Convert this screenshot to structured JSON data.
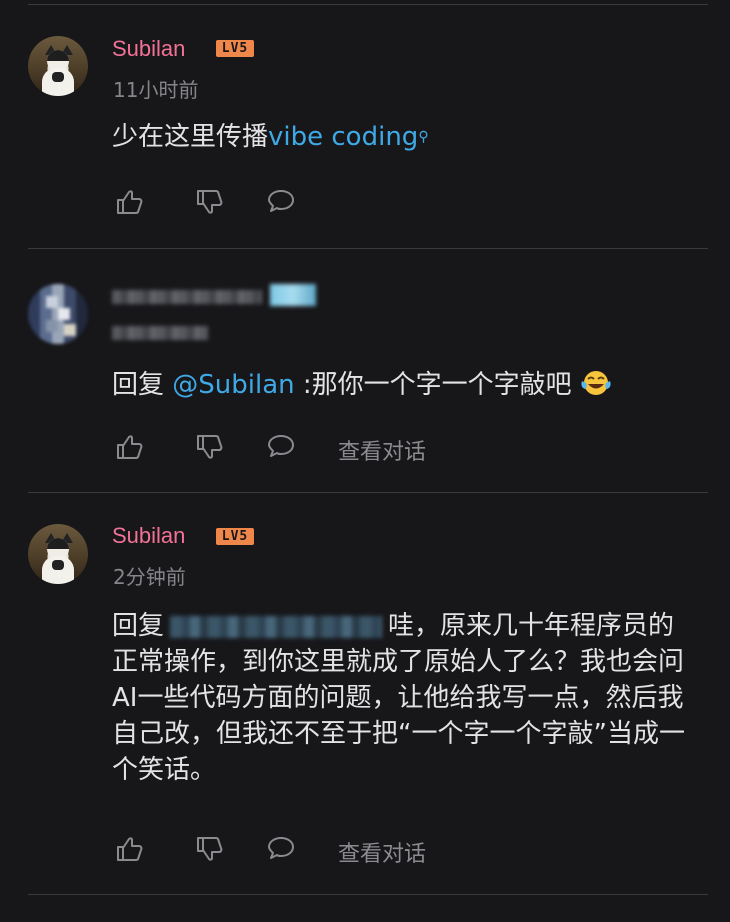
{
  "comments": [
    {
      "username": "Subilan",
      "level": "LV5",
      "time": "11小时前",
      "text_before": "少在这里传播",
      "link": "vibe coding",
      "link_icon": "search-icon"
    },
    {
      "reply_prefix": "回复 ",
      "mention": "@Subilan",
      "text": " :那你一个字一个字敲吧",
      "view_conversation": "查看对话"
    },
    {
      "username": "Subilan",
      "level": "LV5",
      "time": "2分钟前",
      "reply_prefix": "回复",
      "text": "哇，原来几十年程序员的正常操作，到你这里就成了原始人了么？我也会问AI一些代码方面的问题，让他给我写一点，然后我自己改，但我还不至于把“一个字一个字敲”当成一个笑话。",
      "view_conversation": "查看对话"
    }
  ],
  "colors": {
    "username": "#f27296",
    "level_badge": "#f0874a",
    "link": "#3fa9e6",
    "background": "#17171a"
  }
}
